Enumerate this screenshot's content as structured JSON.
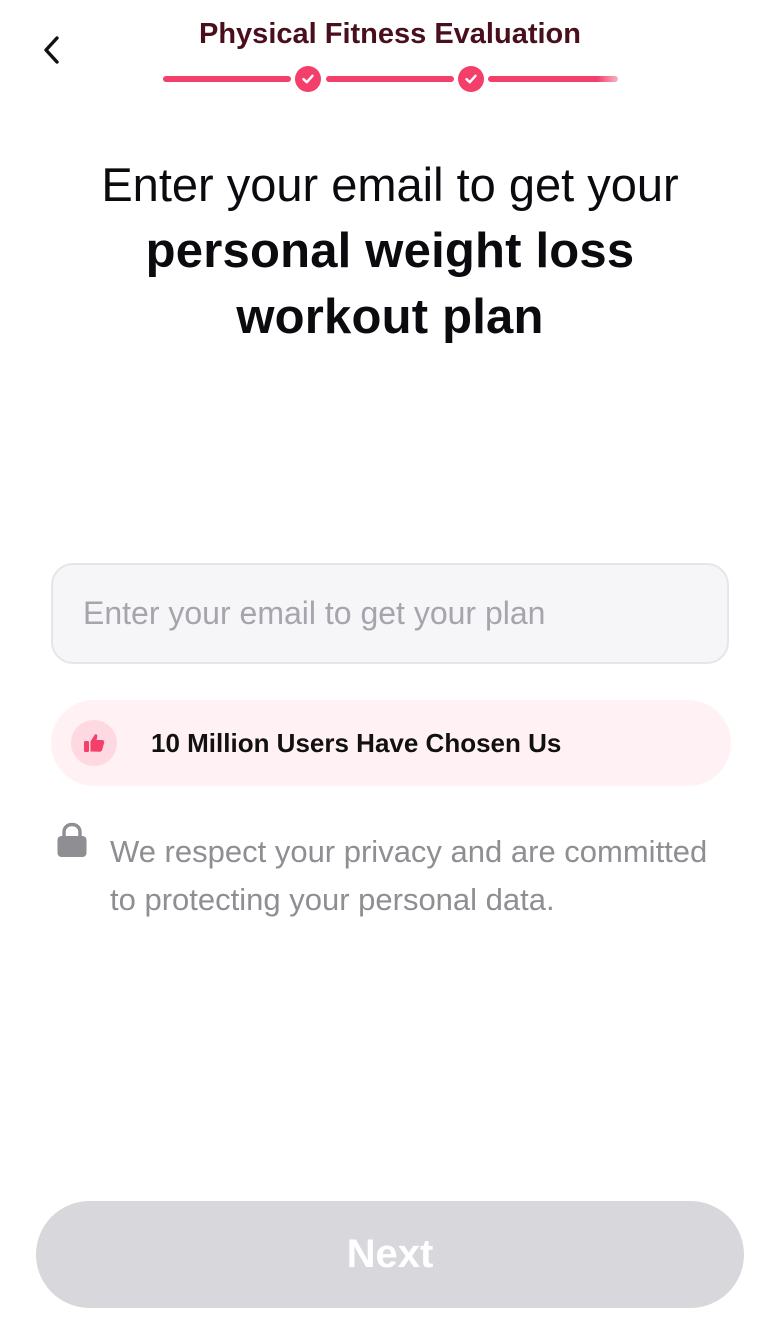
{
  "header": {
    "title": "Physical Fitness Evaluation",
    "back_icon": "chevron-left-icon"
  },
  "progress": {
    "steps_completed": 2,
    "total_segments": 3,
    "accent_color": "#f43f6b"
  },
  "headline": {
    "line1": "Enter your email to get your",
    "line2": "personal weight loss",
    "line3": "workout plan"
  },
  "email": {
    "value": "",
    "placeholder": "Enter your email to get your plan"
  },
  "social_proof": {
    "icon": "thumbs-up-icon",
    "text": "10 Million Users Have Chosen Us"
  },
  "privacy": {
    "icon": "lock-icon",
    "text": "We respect your privacy and are committed to protecting your personal data."
  },
  "footer": {
    "next_label": "Next",
    "next_disabled": true
  }
}
